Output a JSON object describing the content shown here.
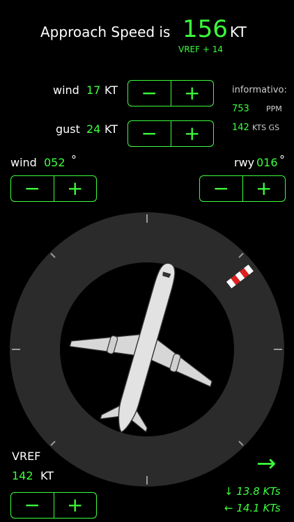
{
  "header": {
    "label": "Approach Speed is",
    "value": "156",
    "unit": "KT",
    "vref_offset": "VREF + 14"
  },
  "wind_speed": {
    "label": "wind",
    "value": "17",
    "unit": "KT"
  },
  "gust": {
    "label": "gust",
    "value": "24",
    "unit": "KT"
  },
  "informativo": {
    "label": "informativo:",
    "ppm_value": "753",
    "ppm_unit": "PPM",
    "gs_value": "142",
    "gs_unit": "KTS GS"
  },
  "wind_dir": {
    "label": "wind",
    "value": "052",
    "unit": "°"
  },
  "runway": {
    "label": "rwy",
    "value": "016",
    "unit": "°"
  },
  "stepper": {
    "minus": "−",
    "plus": "+"
  },
  "vref": {
    "label": "VREF",
    "value": "142",
    "unit": "KT"
  },
  "components": {
    "arrow_icon": "→",
    "headwind": "↓  13.8 KTs",
    "crosswind": "←  14.1 KTs"
  },
  "colors": {
    "accent": "#3cff3c",
    "ring": "#2b2b2b",
    "inner": "#000000"
  }
}
